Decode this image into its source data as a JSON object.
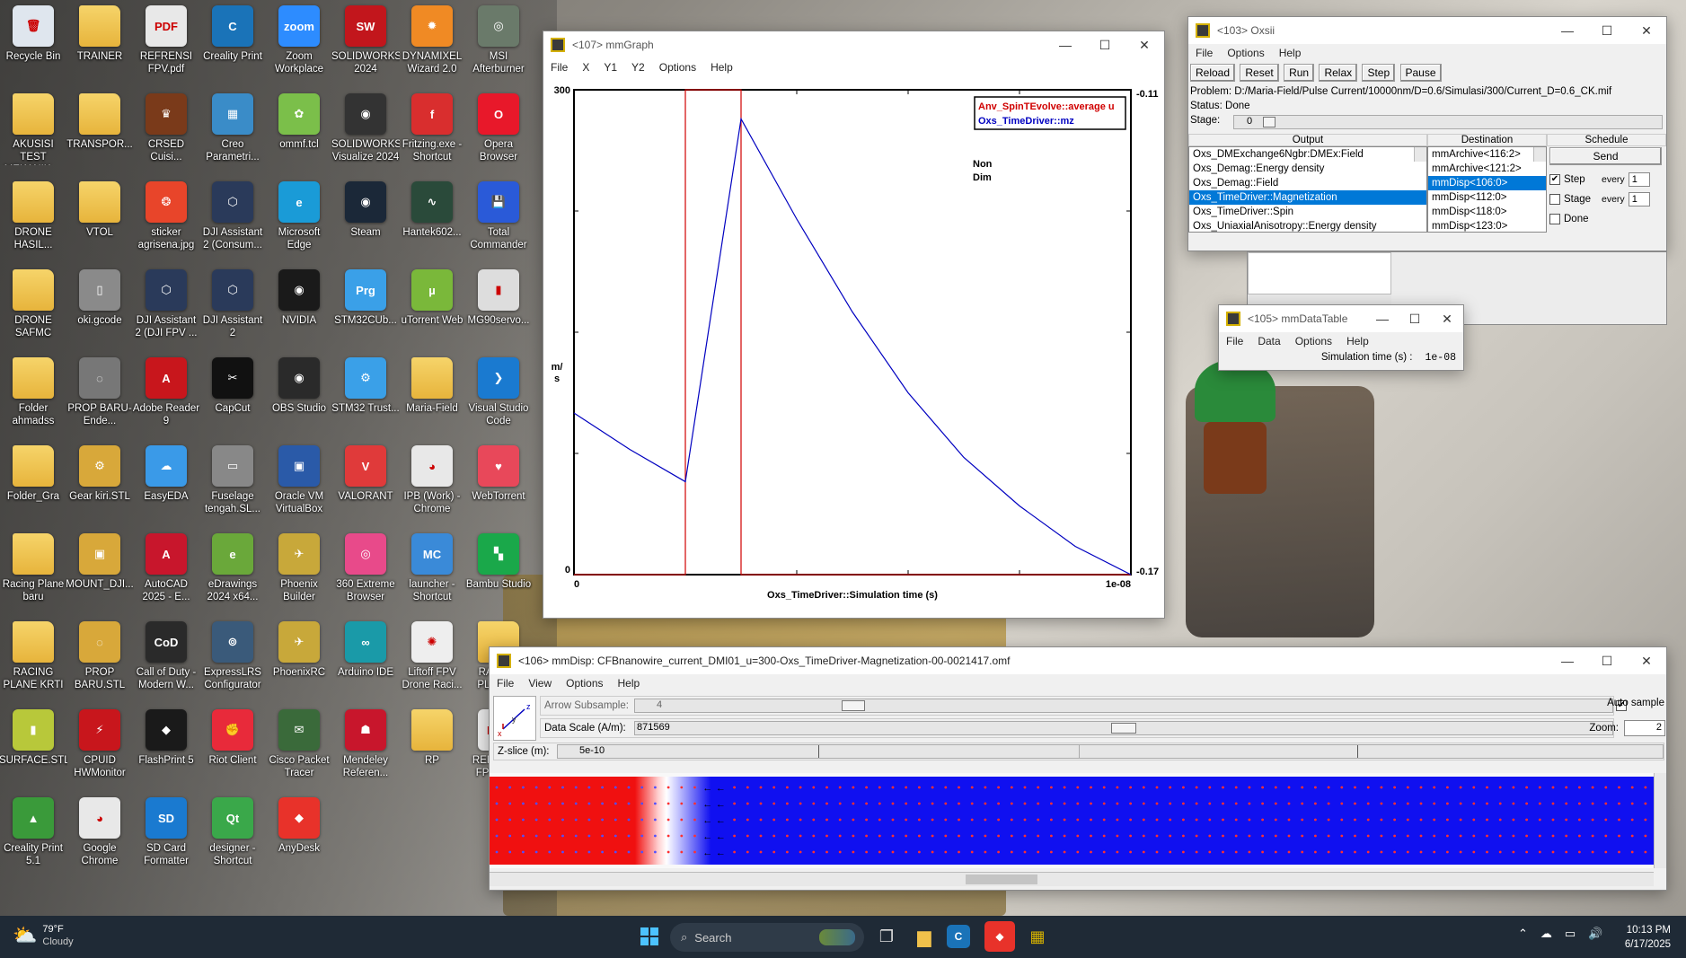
{
  "desktop_icons": [
    {
      "label": "Recycle Bin",
      "glyph": "🗑",
      "color": "#dfe6ee",
      "icon": "recycle-bin-icon"
    },
    {
      "label": "TRAINER",
      "glyph": "",
      "color": "#f0c14b",
      "icon": "folder-icon"
    },
    {
      "label": "REFRENSI FPV.pdf",
      "glyph": "PDF",
      "color": "#e8e8e8",
      "icon": "pdf-icon"
    },
    {
      "label": "Creality Print",
      "glyph": "C",
      "color": "#1a73b8",
      "icon": "creality-icon"
    },
    {
      "label": "Zoom Workplace",
      "glyph": "zoom",
      "color": "#2d8cff",
      "icon": "zoom-icon"
    },
    {
      "label": "SOLIDWORKS 2024",
      "glyph": "SW",
      "color": "#c2161c",
      "icon": "solidworks-icon"
    },
    {
      "label": "DYNAMIXEL Wizard 2.0",
      "glyph": "✹",
      "color": "#f08a24",
      "icon": "dynamixel-icon"
    },
    {
      "label": "MSI Afterburner",
      "glyph": "◎",
      "color": "#6a7a6a",
      "icon": "msi-afterburner-icon"
    },
    {
      "label": "AKUSISI TEST MEKANIK ...",
      "glyph": "",
      "color": "#f0c14b",
      "icon": "folder-icon"
    },
    {
      "label": "TRANSPOR...",
      "glyph": "",
      "color": "#f0c14b",
      "icon": "folder-icon"
    },
    {
      "label": "CRSED Cuisi...",
      "glyph": "♛",
      "color": "#7a3a1a",
      "icon": "crsed-icon"
    },
    {
      "label": "Creo Parametri...",
      "glyph": "▦",
      "color": "#3a8cc8",
      "icon": "creo-icon"
    },
    {
      "label": "ommf.tcl",
      "glyph": "✿",
      "color": "#7bbf4a",
      "icon": "tcl-icon"
    },
    {
      "label": "SOLIDWORKS Visualize 2024",
      "glyph": "◉",
      "color": "#333333",
      "icon": "solidworks-visualize-icon"
    },
    {
      "label": "Fritzing.exe - Shortcut",
      "glyph": "f",
      "color": "#d92e2e",
      "icon": "fritzing-icon"
    },
    {
      "label": "Opera Browser",
      "glyph": "O",
      "color": "#e8182a",
      "icon": "opera-icon"
    },
    {
      "label": "DRONE HASIL...",
      "glyph": "",
      "color": "#f0c14b",
      "icon": "folder-icon"
    },
    {
      "label": "VTOL",
      "glyph": "",
      "color": "#f0c14b",
      "icon": "folder-icon"
    },
    {
      "label": "sticker agrisena.jpg",
      "glyph": "❂",
      "color": "#e8452a",
      "icon": "image-file-icon"
    },
    {
      "label": "DJI Assistant 2 (Consum...",
      "glyph": "⬡",
      "color": "#2a3a5a",
      "icon": "dji-assistant-icon"
    },
    {
      "label": "Microsoft Edge",
      "glyph": "e",
      "color": "#1a9bd7",
      "icon": "edge-icon"
    },
    {
      "label": "Steam",
      "glyph": "◉",
      "color": "#1b2838",
      "icon": "steam-icon"
    },
    {
      "label": "Hantek602...",
      "glyph": "∿",
      "color": "#2a4a3a",
      "icon": "hantek-icon"
    },
    {
      "label": "Total Commander",
      "glyph": "💾",
      "color": "#2a5ad8",
      "icon": "total-commander-icon"
    },
    {
      "label": "DRONE SAFMC",
      "glyph": "",
      "color": "#f0c14b",
      "icon": "folder-icon"
    },
    {
      "label": "oki.gcode",
      "glyph": "▯",
      "color": "#8a8a8a",
      "icon": "gcode-file-icon"
    },
    {
      "label": "DJI Assistant 2 (DJI FPV ...",
      "glyph": "⬡",
      "color": "#2a3a5a",
      "icon": "dji-assistant-icon"
    },
    {
      "label": "DJI Assistant 2",
      "glyph": "⬡",
      "color": "#2a3a5a",
      "icon": "dji-assistant-icon"
    },
    {
      "label": "NVIDIA",
      "glyph": "◉",
      "color": "#1a1a1a",
      "icon": "nvidia-icon"
    },
    {
      "label": "STM32CUb...",
      "glyph": "Prg",
      "color": "#3aa0e8",
      "icon": "stm32-icon"
    },
    {
      "label": "uTorrent Web",
      "glyph": "µ",
      "color": "#7ab83a",
      "icon": "utorrent-icon"
    },
    {
      "label": "MG90servo...",
      "glyph": "▮",
      "color": "#dddddd",
      "icon": "servo-file-icon"
    },
    {
      "label": "Folder ahmadss",
      "glyph": "",
      "color": "#f0c14b",
      "icon": "folder-icon"
    },
    {
      "label": "PROP BARU-Ende...",
      "glyph": "◌",
      "color": "#777777",
      "icon": "prop-file-icon"
    },
    {
      "label": "Adobe Reader 9",
      "glyph": "A",
      "color": "#c8161c",
      "icon": "adobe-reader-icon"
    },
    {
      "label": "CapCut",
      "glyph": "✂",
      "color": "#111111",
      "icon": "capcut-icon"
    },
    {
      "label": "OBS Studio",
      "glyph": "◉",
      "color": "#2a2a2a",
      "icon": "obs-icon"
    },
    {
      "label": "STM32 Trust...",
      "glyph": "⚙",
      "color": "#3aa0e8",
      "icon": "stm32-trust-icon"
    },
    {
      "label": "Maria-Field",
      "glyph": "",
      "color": "#f0c14b",
      "icon": "folder-icon"
    },
    {
      "label": "Visual Studio Code",
      "glyph": "❯",
      "color": "#1a7ad0",
      "icon": "vscode-icon"
    },
    {
      "label": "Folder_Gra",
      "glyph": "",
      "color": "#f0c14b",
      "icon": "folder-icon"
    },
    {
      "label": "Gear kiri.STL",
      "glyph": "⚙",
      "color": "#d8a83a",
      "icon": "stl-file-icon"
    },
    {
      "label": "EasyEDA",
      "glyph": "☁",
      "color": "#3a9ae8",
      "icon": "easyeda-icon"
    },
    {
      "label": "Fuselage tengah.SL...",
      "glyph": "▭",
      "color": "#888888",
      "icon": "stl-file-icon"
    },
    {
      "label": "Oracle VM VirtualBox",
      "glyph": "▣",
      "color": "#2a5aa8",
      "icon": "virtualbox-icon"
    },
    {
      "label": "VALORANT",
      "glyph": "V",
      "color": "#e03a3a",
      "icon": "valorant-icon"
    },
    {
      "label": "IPB (Work) - Chrome",
      "glyph": "◕",
      "color": "#e8e8e8",
      "icon": "chrome-icon"
    },
    {
      "label": "WebTorrent",
      "glyph": "♥",
      "color": "#e8485a",
      "icon": "webtorrent-icon"
    },
    {
      "label": "Racing Plane baru",
      "glyph": "",
      "color": "#f0c14b",
      "icon": "folder-icon"
    },
    {
      "label": "MOUNT_DJI...",
      "glyph": "▣",
      "color": "#d8a83a",
      "icon": "stl-file-icon"
    },
    {
      "label": "AutoCAD 2025 - E...",
      "glyph": "A",
      "color": "#c8162c",
      "icon": "autocad-icon"
    },
    {
      "label": "eDrawings 2024 x64...",
      "glyph": "e",
      "color": "#6aa83a",
      "icon": "edrawings-icon"
    },
    {
      "label": "Phoenix Builder",
      "glyph": "✈",
      "color": "#c8a83a",
      "icon": "phoenix-builder-icon"
    },
    {
      "label": "360 Extreme Browser",
      "glyph": "◎",
      "color": "#e84a8a",
      "icon": "360-browser-icon"
    },
    {
      "label": "launcher - Shortcut",
      "glyph": "MC",
      "color": "#3a8ad8",
      "icon": "launcher-icon"
    },
    {
      "label": "Bambu Studio",
      "glyph": "▚",
      "color": "#1aa84a",
      "icon": "bambu-studio-icon"
    },
    {
      "label": "RACING PLANE KRTI",
      "glyph": "",
      "color": "#f0c14b",
      "icon": "folder-icon"
    },
    {
      "label": "PROP BARU.STL",
      "glyph": "◌",
      "color": "#d8a83a",
      "icon": "stl-file-icon"
    },
    {
      "label": "Call of Duty - Modern W...",
      "glyph": "CoD",
      "color": "#2a2a2a",
      "icon": "call-of-duty-icon"
    },
    {
      "label": "ExpressLRS Configurator",
      "glyph": "⊚",
      "color": "#3a5a7a",
      "icon": "expresslrs-icon"
    },
    {
      "label": "PhoenixRC",
      "glyph": "✈",
      "color": "#c8a83a",
      "icon": "phoenixrc-icon"
    },
    {
      "label": "Arduino IDE",
      "glyph": "∞",
      "color": "#1a9aa8",
      "icon": "arduino-icon"
    },
    {
      "label": "Liftoff FPV Drone Raci...",
      "glyph": "✺",
      "color": "#eeeeee",
      "icon": "liftoff-icon"
    },
    {
      "label": "RACING PLANE...",
      "glyph": "",
      "color": "#f0c14b",
      "icon": "folder-icon"
    },
    {
      "label": "SURFACE.STL",
      "glyph": "▮",
      "color": "#b8c83a",
      "icon": "stl-file-icon"
    },
    {
      "label": "CPUID HWMonitor",
      "glyph": "⚡",
      "color": "#c8161c",
      "icon": "hwmonitor-icon"
    },
    {
      "label": "FlashPrint 5",
      "glyph": "◆",
      "color": "#1a1a1a",
      "icon": "flashprint-icon"
    },
    {
      "label": "Riot Client",
      "glyph": "✊",
      "color": "#e82a3a",
      "icon": "riot-client-icon"
    },
    {
      "label": "Cisco Packet Tracer",
      "glyph": "✉",
      "color": "#3a6a3a",
      "icon": "packet-tracer-icon"
    },
    {
      "label": "Mendeley Referen...",
      "glyph": "☗",
      "color": "#c8162c",
      "icon": "mendeley-icon"
    },
    {
      "label": "RP",
      "glyph": "",
      "color": "#f0c14b",
      "icon": "folder-icon"
    },
    {
      "label": "REFRENSI FPV - C...",
      "glyph": "PDF",
      "color": "#e8e8e8",
      "icon": "pdf-icon"
    },
    {
      "label": "Creality Print 5.1",
      "glyph": "▲",
      "color": "#3a9a3a",
      "icon": "creality-print-icon"
    },
    {
      "label": "Google Chrome",
      "glyph": "◕",
      "color": "#e8e8e8",
      "icon": "chrome-icon"
    },
    {
      "label": "SD Card Formatter",
      "glyph": "SD",
      "color": "#1a7ad0",
      "icon": "sd-card-icon"
    },
    {
      "label": "designer - Shortcut",
      "glyph": "Qt",
      "color": "#3aa84a",
      "icon": "qt-designer-icon"
    },
    {
      "label": "AnyDesk",
      "glyph": "◆",
      "color": "#e8322a",
      "icon": "anydesk-icon"
    }
  ],
  "mmgraph": {
    "title": "<107> mmGraph",
    "menu": [
      "File",
      "X",
      "Y1",
      "Y2",
      "Options",
      "Help"
    ],
    "legend": [
      "Anv_SpinTEvolve::average u",
      "Oxs_TimeDriver::mz"
    ],
    "legend_colors": [
      "#d00000",
      "#0000c0"
    ],
    "y1_label": "m/s",
    "y2_label": "Non Dim",
    "x_label": "Oxs_TimeDriver::Simulation time (s)",
    "y1_ticks": [
      "300",
      "0"
    ],
    "y2_ticks": [
      "-0.11",
      "-0.17"
    ],
    "x_ticks": [
      "0",
      "1e-08"
    ]
  },
  "chart_data": {
    "type": "line",
    "title": "",
    "xlabel": "Oxs_TimeDriver::Simulation time (s)",
    "ylabel": "m/s",
    "y2label": "Non Dim",
    "xlim": [
      0,
      1e-08
    ],
    "ylim": [
      0,
      300
    ],
    "y2lim": [
      -0.17,
      -0.11
    ],
    "legend_position": "top-right",
    "series": [
      {
        "name": "Anv_SpinTEvolve::average u",
        "axis": "y1",
        "color": "#d00000",
        "x": [
          0,
          2e-09,
          2e-09,
          3e-09,
          3e-09,
          1e-08
        ],
        "y": [
          0,
          0,
          300,
          300,
          0,
          0
        ]
      },
      {
        "name": "Oxs_TimeDriver::mz",
        "axis": "y2",
        "color": "#0000c0",
        "x": [
          0,
          1e-09,
          2e-09,
          3e-09,
          4e-09,
          5e-09,
          6e-09,
          7e-09,
          8e-09,
          9e-09,
          1e-08
        ],
        "y": [
          -0.15,
          -0.1545,
          -0.1585,
          -0.1136,
          -0.126,
          -0.1375,
          -0.1475,
          -0.1555,
          -0.1615,
          -0.1665,
          -0.17
        ]
      }
    ]
  },
  "oxsii": {
    "title": "<103> Oxsii",
    "menu": [
      "File",
      "Options",
      "Help"
    ],
    "buttons": [
      "Reload",
      "Reset",
      "Run",
      "Relax",
      "Step",
      "Pause"
    ],
    "problem_label": "Problem:",
    "problem_value": "D:/Maria-Field/Pulse Current/10000nm/D=0.6/Simulasi/300/Current_D=0.6_CK.mif",
    "status_label": "Status:",
    "status_value": "Done",
    "stage_label": "Stage:",
    "stage_value": "0",
    "col_headers": [
      "Output",
      "Destination",
      "Schedule"
    ],
    "outputs": [
      "Oxs_DMExchange6Ngbr:DMEx:Field",
      "Oxs_Demag::Energy density",
      "Oxs_Demag::Field",
      "Oxs_TimeDriver::Magnetization",
      "Oxs_TimeDriver::Spin",
      "Oxs_UniaxialAnisotropy::Energy density"
    ],
    "destinations": [
      "mmArchive<116:2>",
      "mmArchive<121:2>",
      "mmDisp<106:0>",
      "mmDisp<112:0>",
      "mmDisp<118:0>",
      "mmDisp<123:0>"
    ],
    "send_label": "Send",
    "schedule": [
      {
        "label": "Step",
        "checked": true,
        "every": "every",
        "value": "1"
      },
      {
        "label": "Stage",
        "checked": false,
        "every": "every",
        "value": "1"
      },
      {
        "label": "Done",
        "checked": false
      }
    ]
  },
  "mmdatatable": {
    "title": "<105> mmDataTable",
    "menu": [
      "File",
      "Data",
      "Options",
      "Help"
    ],
    "row_label": "Simulation time (s) :",
    "row_value": "1e-08"
  },
  "mmdisp": {
    "title": "<106> mmDisp: CFBnanowire_current_DMI01_u=300-Oxs_TimeDriver-Magnetization-00-0021417.omf",
    "menu": [
      "File",
      "View",
      "Options",
      "Help"
    ],
    "arrow_subsample_label": "Arrow Subsample:",
    "arrow_subsample_value": "4",
    "data_scale_label": "Data Scale (A/m):",
    "data_scale_value": "871569",
    "auto_sample_label": "Auto sample",
    "zoom_label": "Zoom:",
    "zoom_value": "2",
    "zslice_label": "Z-slice (m):",
    "zslice_value": "5e-10",
    "axis_x": "x",
    "axis_y": "y",
    "axis_z": "z"
  },
  "taskbar": {
    "weather_temp": "79°F",
    "weather_desc": "Cloudy",
    "search_placeholder": "Search",
    "time": "10:13 PM",
    "date": "6/17/2025"
  }
}
